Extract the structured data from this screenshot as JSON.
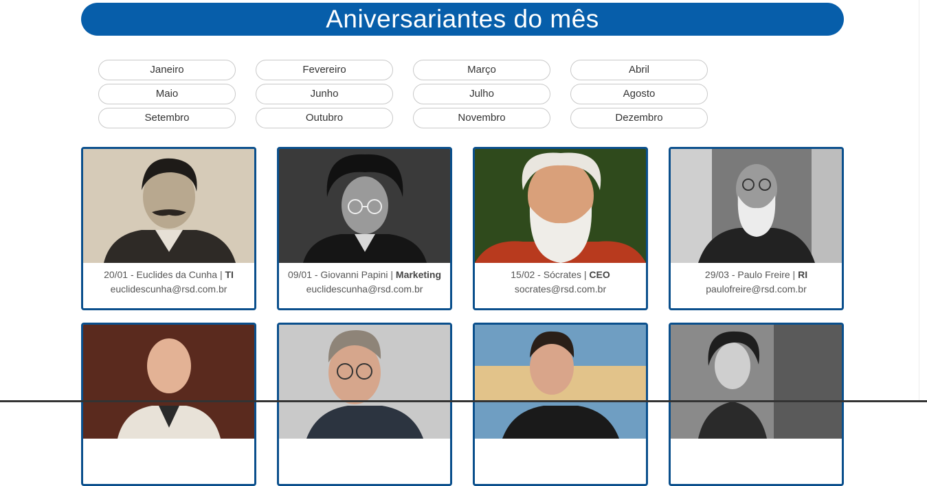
{
  "header": {
    "title": "Aniversariantes do mês"
  },
  "months": [
    "Janeiro",
    "Fevereiro",
    "Março",
    "Abril",
    "Maio",
    "Junho",
    "Julho",
    "Agosto",
    "Setembro",
    "Outubro",
    "Novembro",
    "Dezembro"
  ],
  "cards": [
    {
      "date_name": "20/01 - Euclides da Cunha | ",
      "dept": "TI",
      "email": "euclidescunha@rsd.com.br"
    },
    {
      "date_name": "09/01 - Giovanni Papini | ",
      "dept": "Marketing",
      "email": "euclidescunha@rsd.com.br"
    },
    {
      "date_name": "15/02 - Sócrates | ",
      "dept": "CEO",
      "email": "socrates@rsd.com.br"
    },
    {
      "date_name": "29/03 - Paulo Freire | ",
      "dept": "RI",
      "email": "paulofreire@rsd.com.br"
    }
  ],
  "colors": {
    "accent": "#075eaa",
    "card_border": "#0a4f8c"
  }
}
